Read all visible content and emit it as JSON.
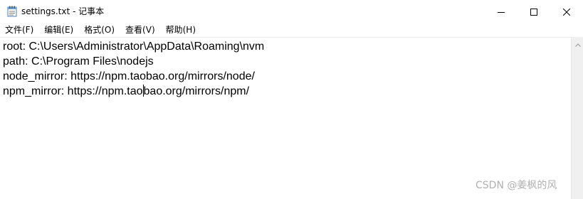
{
  "window": {
    "title": "settings.txt - 记事本"
  },
  "menu": {
    "items": [
      {
        "label": "文件(F)"
      },
      {
        "label": "编辑(E)"
      },
      {
        "label": "格式(O)"
      },
      {
        "label": "查看(V)"
      },
      {
        "label": "帮助(H)"
      }
    ]
  },
  "editor": {
    "lines": [
      {
        "text": "root: C:\\Users\\Administrator\\AppData\\Roaming\\nvm"
      },
      {
        "text": "path: C:\\Program Files\\nodejs"
      },
      {
        "text": "node_mirror: https://npm.taobao.org/mirrors/node/"
      },
      {
        "text_before_caret": "npm_mirror: https://npm.tao",
        "text_after_caret": "bao.org/mirrors/npm/"
      }
    ]
  },
  "watermark": {
    "text": "CSDN @姜枫的风"
  },
  "icons": {
    "app": "notepad-icon",
    "minimize": "minimize-icon",
    "maximize": "maximize-icon",
    "close": "close-icon",
    "scroll_up": "chevron-up-icon"
  }
}
